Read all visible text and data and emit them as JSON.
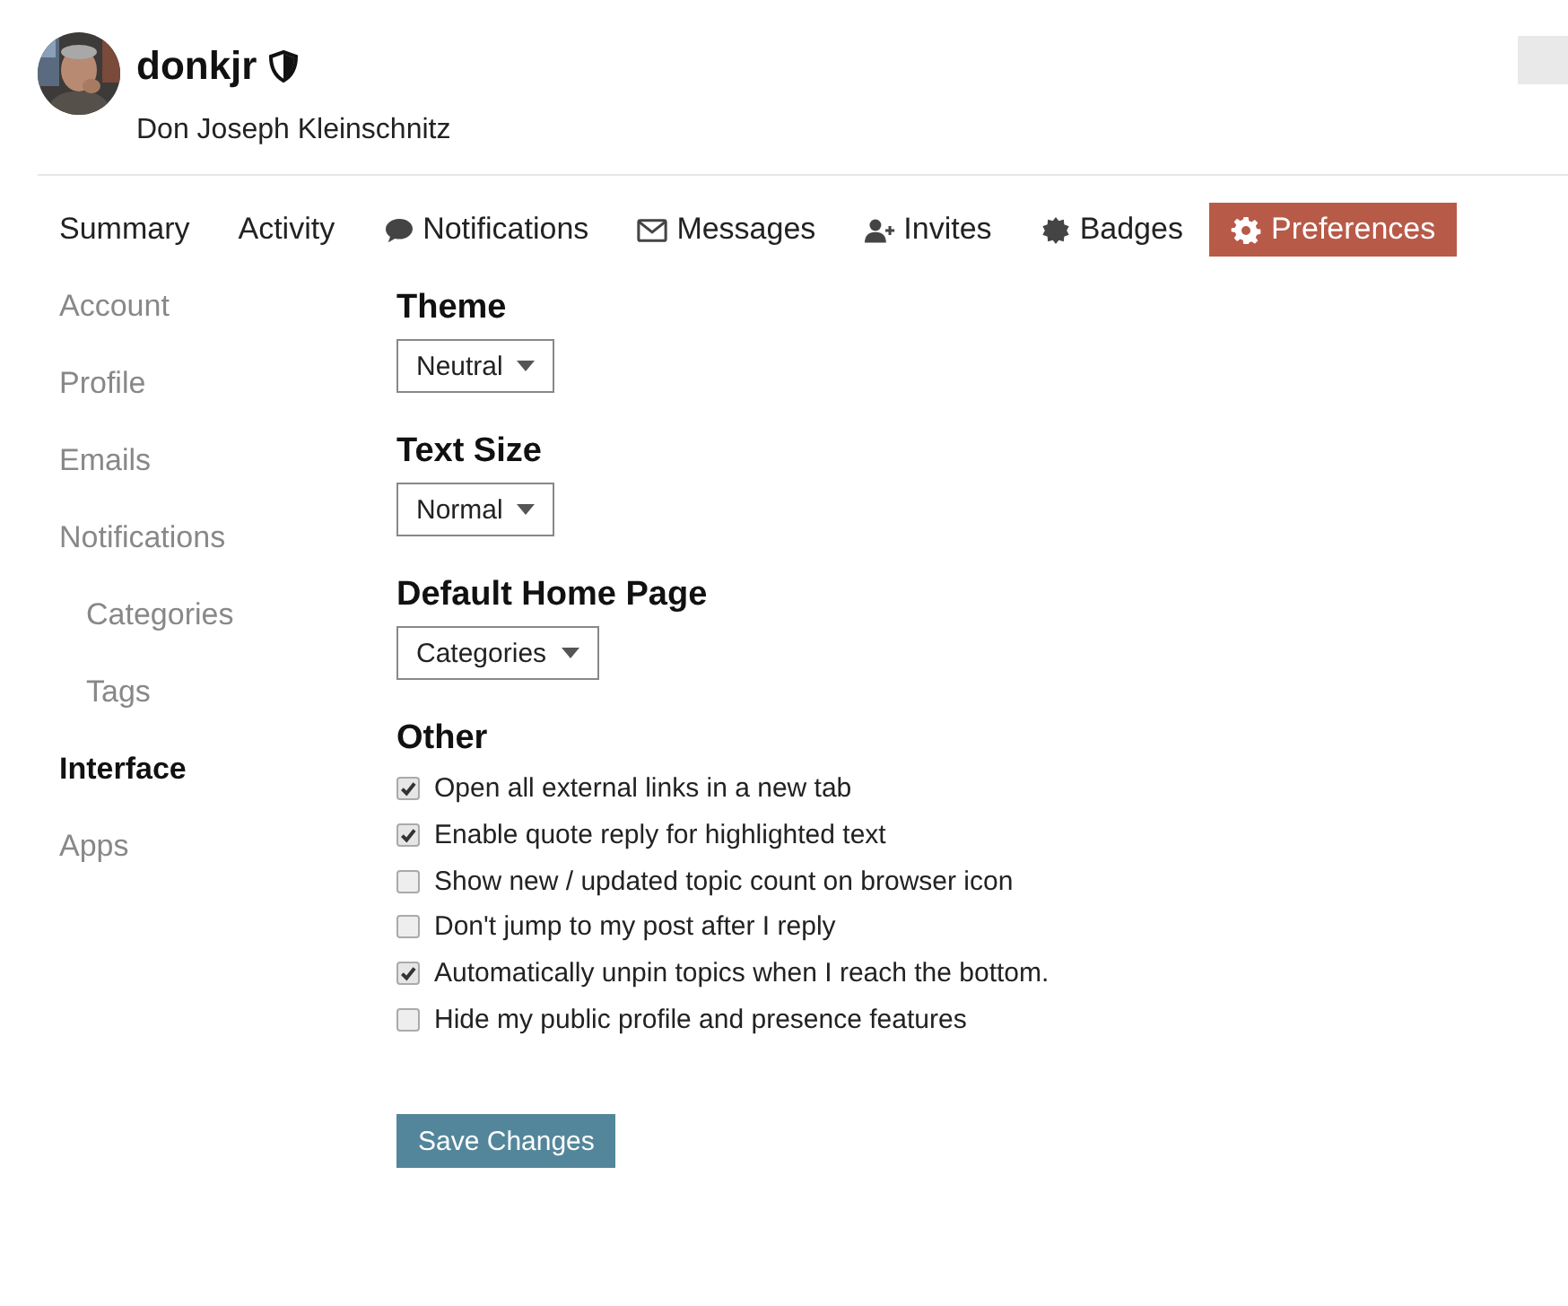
{
  "user": {
    "username": "donkjr",
    "full_name": "Don Joseph Kleinschnitz"
  },
  "tabs": [
    {
      "label": "Summary",
      "selected": false
    },
    {
      "label": "Activity",
      "selected": false
    },
    {
      "label": "Notifications",
      "selected": false
    },
    {
      "label": "Messages",
      "selected": false
    },
    {
      "label": "Invites",
      "selected": false
    },
    {
      "label": "Badges",
      "selected": false
    },
    {
      "label": "Preferences",
      "selected": true
    }
  ],
  "sidebar": {
    "items": [
      {
        "label": "Account",
        "selected": false
      },
      {
        "label": "Profile",
        "selected": false
      },
      {
        "label": "Emails",
        "selected": false
      },
      {
        "label": "Notifications",
        "selected": false,
        "children": [
          {
            "label": "Categories",
            "selected": false
          },
          {
            "label": "Tags",
            "selected": false
          }
        ]
      },
      {
        "label": "Interface",
        "selected": true
      },
      {
        "label": "Apps",
        "selected": false
      }
    ]
  },
  "settings": [
    {
      "heading": "Theme",
      "value": "Neutral"
    },
    {
      "heading": "Text Size",
      "value": "Normal"
    },
    {
      "heading": "Default Home Page",
      "value": "Categories"
    }
  ],
  "other": {
    "heading": "Other",
    "options": [
      {
        "label": "Open all external links in a new tab",
        "checked": true
      },
      {
        "label": "Enable quote reply for highlighted text",
        "checked": true
      },
      {
        "label": "Show new / updated topic count on browser icon",
        "checked": false
      },
      {
        "label": "Don't jump to my post after I reply",
        "checked": false
      },
      {
        "label": "Automatically unpin topics when I reach the bottom.",
        "checked": true
      },
      {
        "label": "Hide my public profile and presence features",
        "checked": false
      }
    ]
  },
  "save_button": "Save Changes"
}
